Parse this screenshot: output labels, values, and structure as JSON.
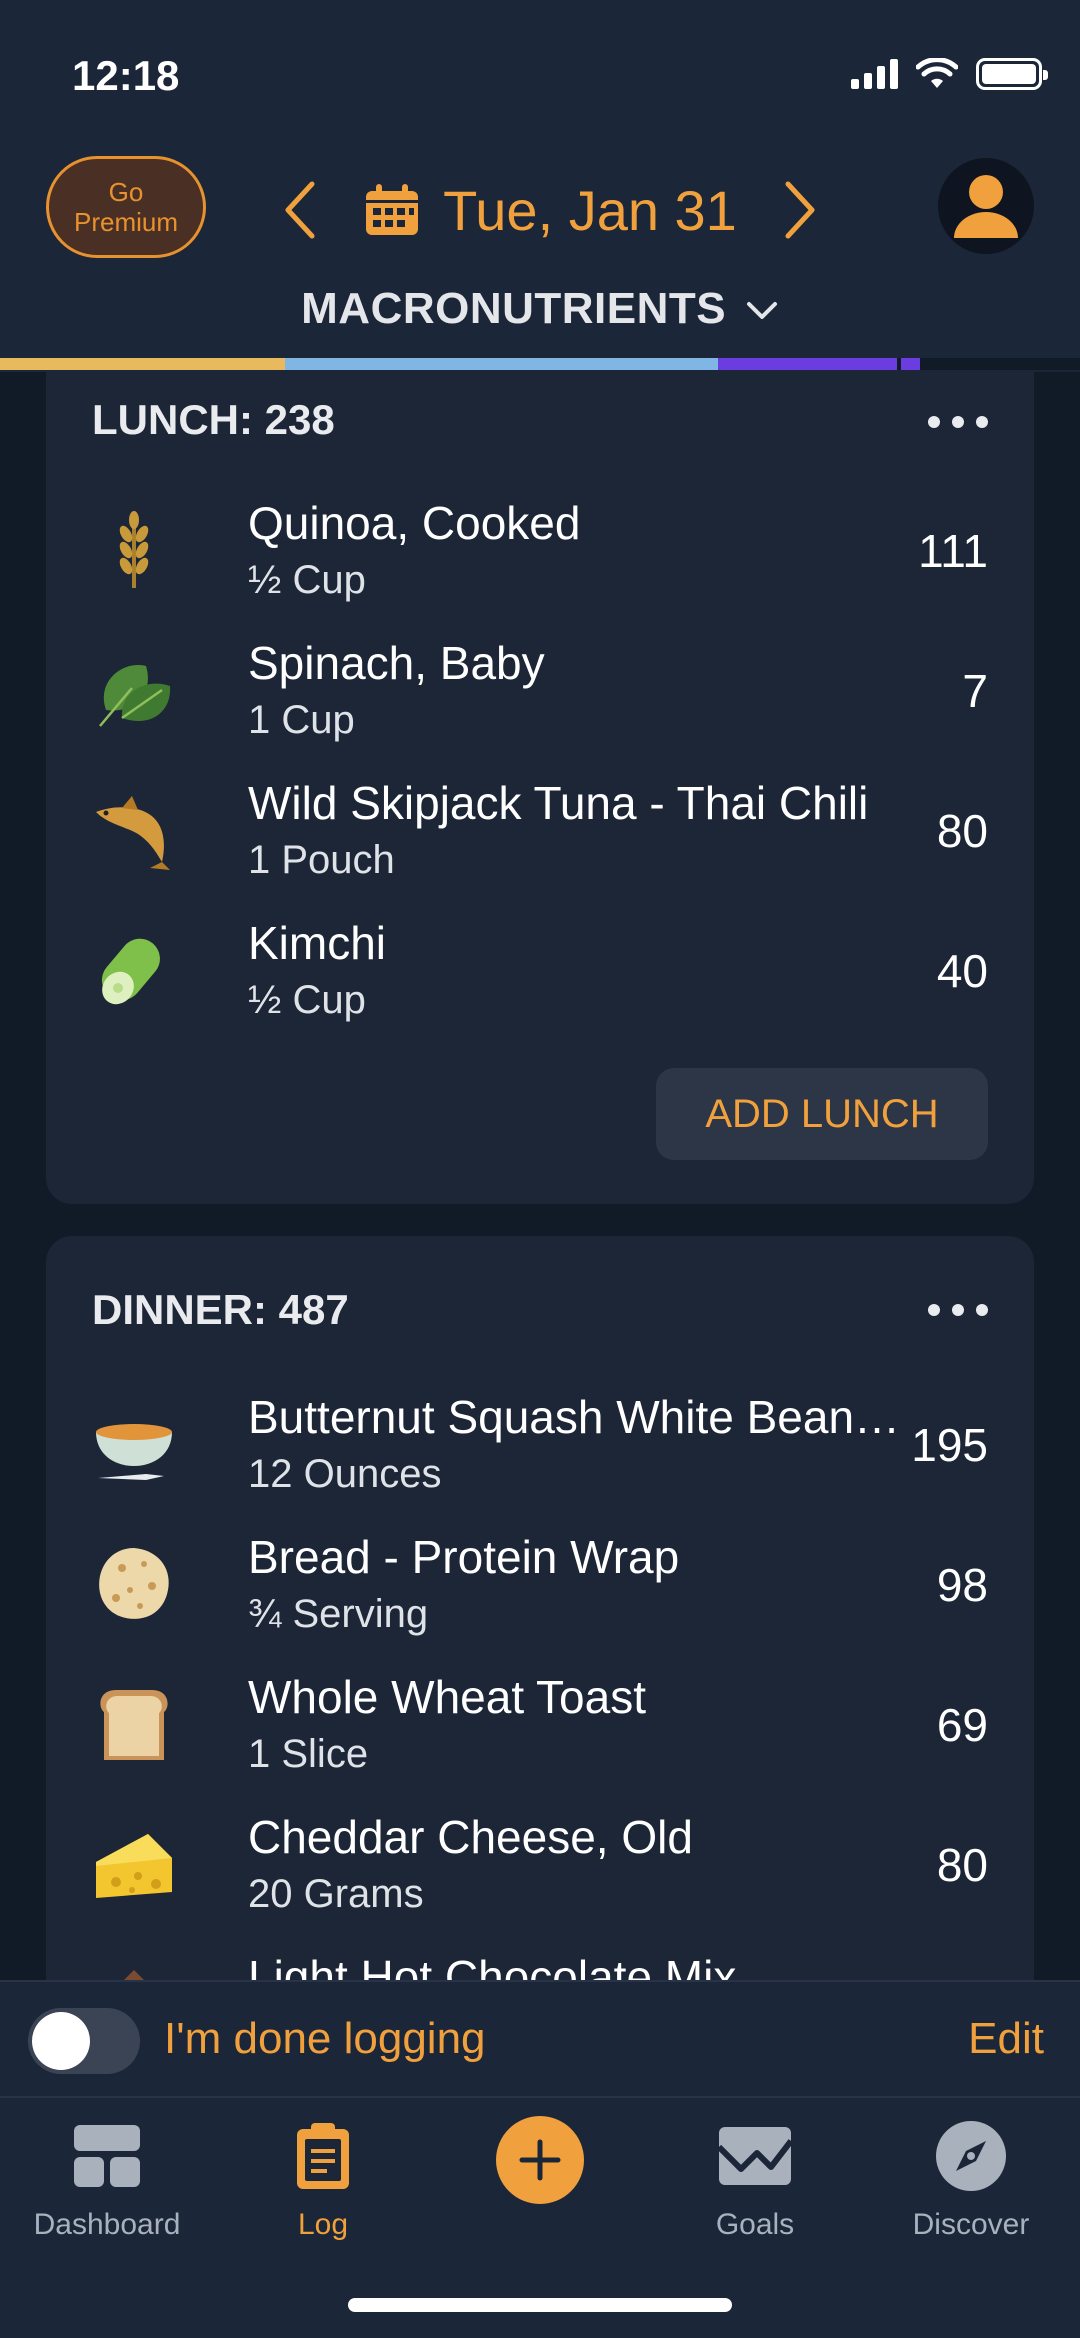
{
  "status_bar": {
    "time": "12:18"
  },
  "header": {
    "premium_line1": "Go",
    "premium_line2": "Premium",
    "date": "Tue, Jan 31",
    "section_label": "MACRONUTRIENTS"
  },
  "macro_bar_colors": [
    "#e9b95d",
    "#7fb6e3",
    "#6b3de0"
  ],
  "lunch": {
    "title": "LUNCH: 238",
    "add_label": "ADD LUNCH",
    "items": [
      {
        "name": "Quinoa, Cooked",
        "serving": "½ Cup",
        "calories": "111",
        "icon": "wheat-icon"
      },
      {
        "name": "Spinach, Baby",
        "serving": "1 Cup",
        "calories": "7",
        "icon": "spinach-icon"
      },
      {
        "name": "Wild Skipjack Tuna - Thai Chili",
        "serving": "1 Pouch",
        "calories": "80",
        "icon": "fish-icon"
      },
      {
        "name": "Kimchi",
        "serving": "½ Cup",
        "calories": "40",
        "icon": "cucumber-icon"
      }
    ]
  },
  "dinner": {
    "title": "DINNER: 487",
    "items": [
      {
        "name": "Butternut Squash White Bean…",
        "serving": "12 Ounces",
        "calories": "195",
        "icon": "soup-bowl-icon"
      },
      {
        "name": "Bread - Protein Wrap",
        "serving": "¾ Serving",
        "calories": "98",
        "icon": "flatbread-icon"
      },
      {
        "name": "Whole Wheat Toast",
        "serving": "1 Slice",
        "calories": "69",
        "icon": "toast-icon"
      },
      {
        "name": "Cheddar Cheese, Old",
        "serving": "20 Grams",
        "calories": "80",
        "icon": "cheese-icon"
      },
      {
        "name": "Light Hot Chocolate Mix",
        "serving": "",
        "calories": "",
        "icon": "chocolate-icon"
      }
    ]
  },
  "done_bar": {
    "label": "I'm done logging",
    "edit": "Edit"
  },
  "tabs": [
    {
      "label": "Dashboard",
      "icon": "dashboard-icon"
    },
    {
      "label": "Log",
      "icon": "clipboard-icon"
    },
    {
      "label": "",
      "icon": "plus-icon"
    },
    {
      "label": "Goals",
      "icon": "goals-icon"
    },
    {
      "label": "Discover",
      "icon": "compass-icon"
    }
  ],
  "colors": {
    "accent": "#f0a03c",
    "card": "#1c2637",
    "header": "#1b2638"
  }
}
